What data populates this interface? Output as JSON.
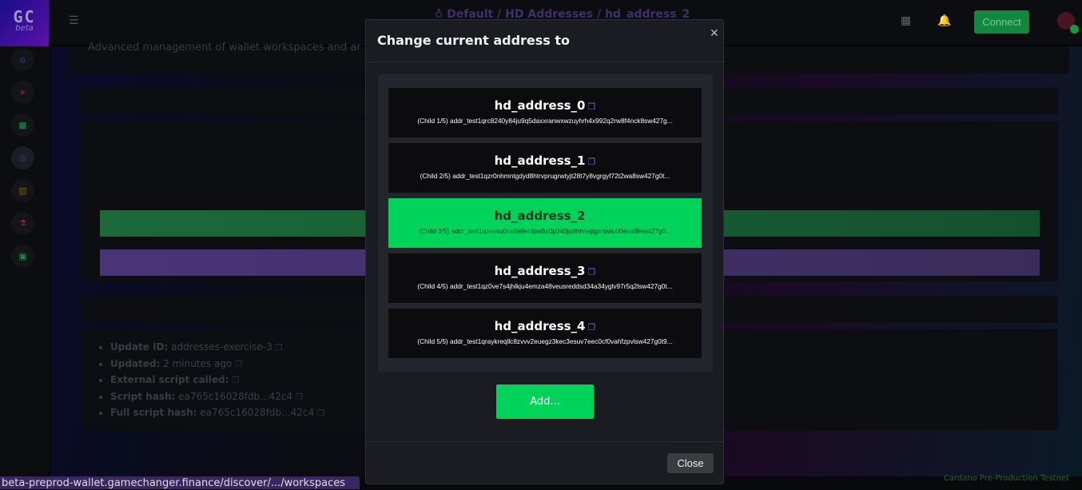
{
  "logo": {
    "text": "GC",
    "sub": "beta"
  },
  "header": {
    "breadcrumb": [
      "Default",
      "HD Addresses",
      "hd_address_2"
    ],
    "connect_label": "Connect"
  },
  "page": {
    "subtitle": "Advanced management of wallet workspaces and ar",
    "info": [
      {
        "label": "Update ID:",
        "value": "addresses-exercise-3"
      },
      {
        "label": "Updated:",
        "value": "2 minutes ago"
      },
      {
        "label": "External script called:",
        "value": ""
      },
      {
        "label": "Script hash:",
        "value": "ea765c16028fdb...42c4"
      },
      {
        "label": "Full script hash:",
        "value": "ea765c16028fdb...42c4"
      }
    ]
  },
  "modal": {
    "title": "Change current address to",
    "addresses": [
      {
        "name": "hd_address_0",
        "line": "(Child 1/5) addr_test1qrc8240y84ju9q5daxxranwxwzuyhrh4x992q2rw8f4nck8sw427g..."
      },
      {
        "name": "hd_address_1",
        "line": "(Child 2/5) addr_test1qzr0nhmntgdyd8htrvprugrwtyjt28t7y8vgrgyf72t2wa8sw427g0t..."
      },
      {
        "name": "hd_address_2",
        "line": "(Child 3/5) addr_test1qzsvsu0cs5lefeldpw8a0p340jq8hhnajtgsrpwu00exaf8sw427g0..."
      },
      {
        "name": "hd_address_3",
        "line": "(Child 4/5) addr_test1qz0ve7s4jhlkju4emza48veusreddsd34a34yglv97r5q2lsw427g0t..."
      },
      {
        "name": "hd_address_4",
        "line": "(Child 5/5) addr_test1qraykreqllc8zvvv2euegz3kec3esuv7eec0cf0vahfzpvlsw427g0t9..."
      }
    ],
    "selected_index": 2,
    "add_label": "Add...",
    "close_label": "Close"
  },
  "statusbar": {
    "url": "beta-preprod-wallet.gamechanger.finance/discover/.../workspaces",
    "network": "Cardano Pre-Production Testnet"
  },
  "colors": {
    "accent": "#00d35a",
    "brand": "#5a12a8"
  }
}
